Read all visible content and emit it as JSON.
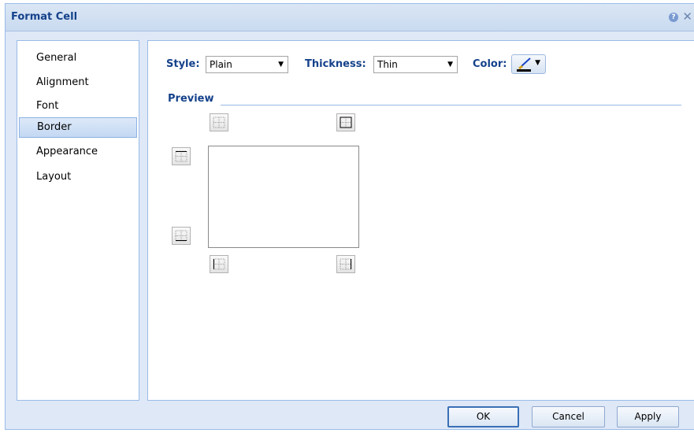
{
  "dialog": {
    "title": "Format Cell",
    "help_glyph": "?",
    "close_glyph": "✕"
  },
  "sidebar": {
    "items": [
      {
        "label": "General",
        "selected": false
      },
      {
        "label": "Alignment",
        "selected": false
      },
      {
        "label": "Font",
        "selected": false
      },
      {
        "label": "Border",
        "selected": true
      },
      {
        "label": "Appearance",
        "selected": false
      },
      {
        "label": "Layout",
        "selected": false
      }
    ]
  },
  "border": {
    "style_label": "Style:",
    "style_value": "Plain",
    "thickness_label": "Thickness:",
    "thickness_value": "Thin",
    "color_label": "Color:",
    "color_value": "#000000",
    "dropdown_glyph": "▼",
    "preview_label": "Preview"
  },
  "footer": {
    "ok_label": "OK",
    "cancel_label": "Cancel",
    "apply_label": "Apply"
  },
  "colors": {
    "accent": "#15428b",
    "panel_background": "#dfe8f6",
    "border": "#99bbe8"
  },
  "icons": {
    "help": "help-icon",
    "close": "close-icon",
    "brush": "paintbrush-icon",
    "border_buttons": [
      "border-horizontal-inner-icon",
      "border-outside-icon",
      "border-top-icon",
      "border-bottom-icon",
      "border-left-icon",
      "border-right-icon"
    ]
  }
}
